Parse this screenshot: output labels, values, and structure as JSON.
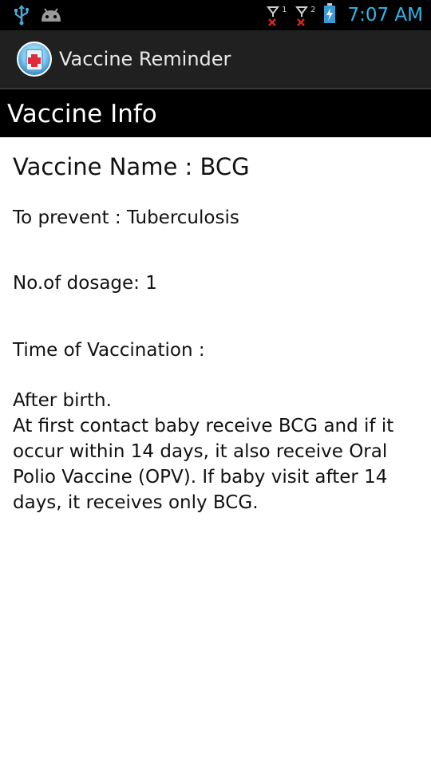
{
  "status_bar": {
    "time": "7:07 AM",
    "left_icons": [
      "usb-icon",
      "android-debug-icon"
    ],
    "right_icons": [
      "signal-sim1-no-service-icon",
      "signal-sim2-no-service-icon",
      "battery-charging-icon"
    ],
    "sim1_label": "1",
    "sim2_label": "2",
    "clock_color": "#33b5e5"
  },
  "action_bar": {
    "icon": "vaccine-app-icon",
    "title": "Vaccine Reminder"
  },
  "section": {
    "title": "Vaccine Info"
  },
  "vaccine": {
    "name_line": "Vaccine Name : BCG",
    "prevent_line": "To prevent : Tuberculosis",
    "dosage_line": "No.of dosage: 1",
    "time_label": "Time of Vaccination :",
    "description": "After birth.\nAt first contact baby receive BCG and if it occur within 14 days, it also receive Oral Polio Vaccine (OPV). If baby visit after 14 days, it receives only BCG."
  }
}
